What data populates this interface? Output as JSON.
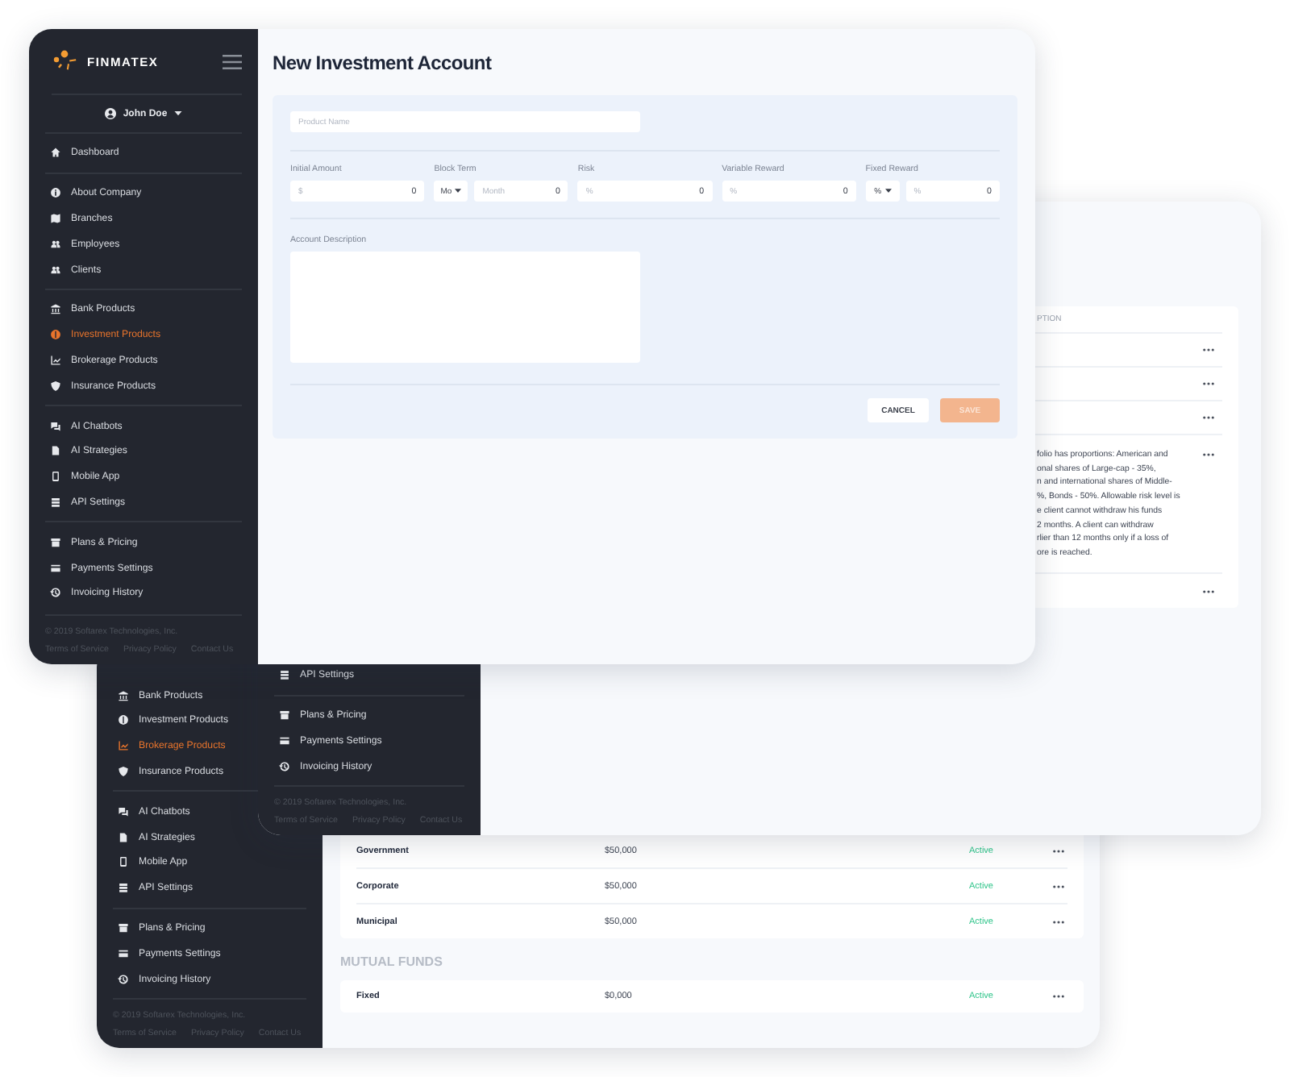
{
  "main_window": {
    "sidebar": {
      "brand": "FINMATEX",
      "user": "John Doe",
      "groups": [
        [
          {
            "label": "Dashboard",
            "kind": "home",
            "selected": false
          }
        ],
        [
          {
            "label": "About Company",
            "kind": "info",
            "selected": false
          },
          {
            "label": "Branches",
            "kind": "map",
            "selected": false
          },
          {
            "label": "Employees",
            "kind": "users",
            "selected": false
          },
          {
            "label": "Clients",
            "kind": "users",
            "selected": false
          }
        ],
        [
          {
            "label": "Bank Products",
            "kind": "bank",
            "selected": false
          },
          {
            "label": "Investment Products",
            "kind": "dollar",
            "selected": true
          },
          {
            "label": "Brokerage Products",
            "kind": "chart",
            "selected": false
          },
          {
            "label": "Insurance Products",
            "kind": "shield",
            "selected": false
          }
        ],
        [
          {
            "label": "AI Chatbots",
            "kind": "chat",
            "selected": false
          },
          {
            "label": "AI Strategies",
            "kind": "document",
            "selected": false
          },
          {
            "label": "Mobile App",
            "kind": "phone",
            "selected": false
          },
          {
            "label": "API Settings",
            "kind": "database",
            "selected": false
          }
        ],
        [
          {
            "label": "Plans & Pricing",
            "kind": "archive",
            "selected": false
          },
          {
            "label": "Payments Settings",
            "kind": "card",
            "selected": false
          },
          {
            "label": "Invoicing History",
            "kind": "history",
            "selected": false
          }
        ]
      ],
      "copyright": "© 2019 Softarex Technologies, Inc.",
      "links": [
        "Terms of Service",
        "Privacy Policy",
        "Contact Us"
      ]
    },
    "title": "New Investment Account",
    "form": {
      "product_name": {
        "placeholder": "Product Name"
      },
      "fields": [
        {
          "label": "Initial Amount",
          "kind": "input",
          "placeholder": "$",
          "value": "0"
        },
        {
          "label": "Block Term",
          "kind": "select-input",
          "option": "Mo",
          "placeholder": "Month",
          "value": "0"
        },
        {
          "label": "Risk",
          "kind": "input",
          "placeholder": "%",
          "value": "0"
        },
        {
          "label": "Variable Reward",
          "kind": "input",
          "placeholder": "%",
          "value": "0"
        },
        {
          "label": "Fixed Reward",
          "kind": "select-input",
          "option": "%",
          "placeholder": "%",
          "value": "0"
        }
      ],
      "description": {
        "label": "Account Description"
      },
      "buttons": [
        {
          "label": "CANCEL",
          "kind": "secondary",
          "disabled": false
        },
        {
          "label": "SAVE",
          "kind": "primary",
          "disabled": true
        }
      ]
    }
  },
  "table_window": {
    "sidebar": {
      "groups": [
        [
          {
            "label": "API Settings",
            "kind": "database",
            "selected": false
          }
        ],
        [
          {
            "label": "Plans & Pricing",
            "kind": "archive",
            "selected": false
          },
          {
            "label": "Payments Settings",
            "kind": "card",
            "selected": false
          },
          {
            "label": "Invoicing History",
            "kind": "history",
            "selected": false
          }
        ]
      ],
      "copyright": "© 2019 Softarex Technologies, Inc.",
      "links": [
        "Terms of Service",
        "Privacy Policy",
        "Contact Us"
      ]
    },
    "table": {
      "column_header": "PTION",
      "rows": [
        {
          "kind": "collapsed"
        },
        {
          "kind": "collapsed"
        },
        {
          "kind": "collapsed"
        },
        {
          "kind": "expanded",
          "description_lines": [
            "folio has proportions: American and",
            "onal shares of Large-cap - 35%,",
            "n and international shares of Middle-",
            "%, Bonds - 50%. Allowable risk level is",
            "e client cannot withdraw his funds",
            "2 months. A client can withdraw",
            "rlier than 12 months only if a loss of",
            "ore is reached."
          ]
        },
        {
          "kind": "collapsed"
        }
      ]
    }
  },
  "list_window": {
    "sidebar": {
      "groups": [
        [
          {
            "label": "Bank Products",
            "kind": "bank",
            "selected": false
          },
          {
            "label": "Investment Products",
            "kind": "dollar",
            "selected": false
          },
          {
            "label": "Brokerage Products",
            "kind": "chart",
            "selected": true
          },
          {
            "label": "Insurance Products",
            "kind": "shield",
            "selected": false
          }
        ],
        [
          {
            "label": "AI Chatbots",
            "kind": "chat",
            "selected": false
          },
          {
            "label": "AI Strategies",
            "kind": "document",
            "selected": false
          },
          {
            "label": "Mobile App",
            "kind": "phone",
            "selected": false
          },
          {
            "label": "API Settings",
            "kind": "database",
            "selected": false
          }
        ],
        [
          {
            "label": "Plans & Pricing",
            "kind": "archive",
            "selected": false
          },
          {
            "label": "Payments Settings",
            "kind": "card",
            "selected": false
          },
          {
            "label": "Invoicing History",
            "kind": "history",
            "selected": false
          }
        ]
      ],
      "copyright": "© 2019 Softarex Technologies, Inc.",
      "links": [
        "Terms of Service",
        "Privacy Policy",
        "Contact Us"
      ]
    },
    "tables": [
      {
        "rows": [
          {
            "name": "Government",
            "amount": "$50,000",
            "status": "Active"
          },
          {
            "name": "Corporate",
            "amount": "$50,000",
            "status": "Active"
          },
          {
            "name": "Municipal",
            "amount": "$50,000",
            "status": "Active"
          }
        ]
      },
      {
        "title": "MUTUAL FUNDS",
        "rows": [
          {
            "name": "Fixed",
            "amount": "$0,000",
            "status": "Active"
          }
        ]
      }
    ]
  }
}
